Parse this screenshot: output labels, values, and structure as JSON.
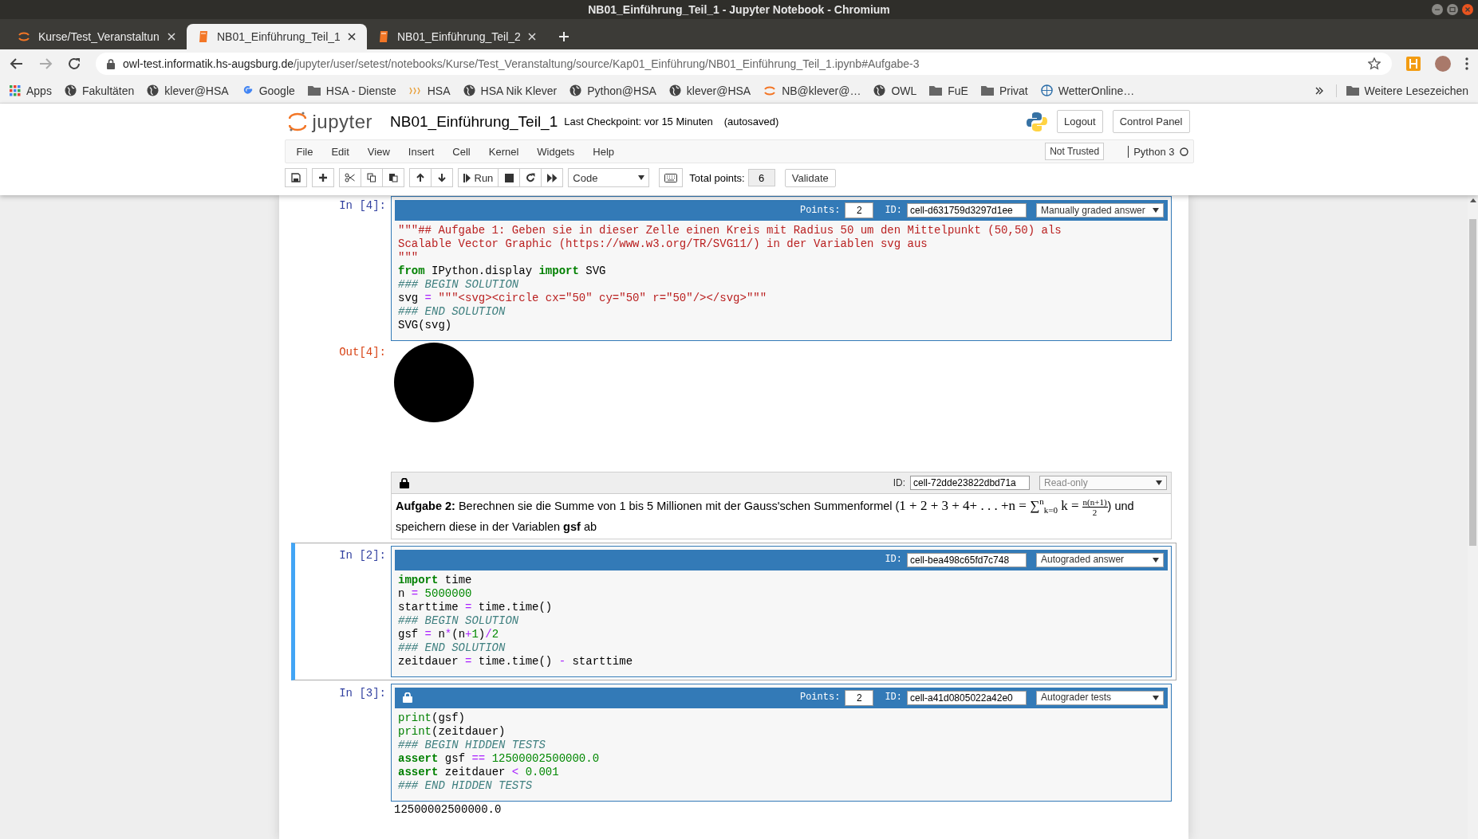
{
  "window": {
    "title": "NB01_Einführung_Teil_1 - Jupyter Notebook - Chromium"
  },
  "tabs": [
    {
      "title": "Kurse/Test_Veranstaltun",
      "selected": false
    },
    {
      "title": "NB01_Einführung_Teil_1",
      "selected": true
    },
    {
      "title": "NB01_Einführung_Teil_2",
      "selected": false
    }
  ],
  "address": {
    "host": "owl-test.informatik.hs-augsburg.de",
    "path": "/jupyter/user/setest/notebooks/Kurse/Test_Veranstaltung/source/Kap01_Einführung/NB01_Einführung_Teil_1.ipynb#Aufgabe-3"
  },
  "bookmarks": [
    {
      "label": "Apps"
    },
    {
      "label": "Fakultäten"
    },
    {
      "label": "klever@HSA"
    },
    {
      "label": "Google"
    },
    {
      "label": "HSA - Dienste"
    },
    {
      "label": "HSA"
    },
    {
      "label": "HSA Nik Klever"
    },
    {
      "label": "Python@HSA"
    },
    {
      "label": "klever@HSA"
    },
    {
      "label": "NB@klever@…"
    },
    {
      "label": "OWL"
    },
    {
      "label": "FuE"
    },
    {
      "label": "Privat"
    },
    {
      "label": "WetterOnline…"
    }
  ],
  "other_bookmarks": "Weitere Lesezeichen",
  "jupyter": {
    "logo_text": "jupyter",
    "notebook_name": "NB01_Einführung_Teil_1",
    "checkpoint": "Last Checkpoint: vor 15 Minuten",
    "autosave": "(autosaved)",
    "buttons": [
      "Logout",
      "Control Panel"
    ],
    "menu": [
      "File",
      "Edit",
      "View",
      "Insert",
      "Cell",
      "Kernel",
      "Widgets",
      "Help"
    ],
    "trust": "Not Trusted",
    "kernel": "Python 3",
    "kernel_busy": false,
    "toolbar": {
      "run": "Run",
      "cell_type": "Code",
      "total_points_label": "Total points:",
      "total_points": "6",
      "validate": "Validate"
    }
  },
  "cells": [
    {
      "kind": "code",
      "prompt": "In [4]:",
      "selected": false,
      "locked": false,
      "header": {
        "points_label": "Points:",
        "points": "2",
        "id_label": "ID:",
        "id": "cell-d631759d3297d1ee",
        "type": "Manually graded answer",
        "disabled": false
      },
      "lines": [
        [
          {
            "kind": "str",
            "text": "\"\"\"## Aufgabe 1: Geben sie in dieser Zelle einen Kreis mit Radius 50 um den Mittelpunkt (50,50) als"
          }
        ],
        [
          {
            "kind": "str",
            "text": "Scalable Vector Graphic (https://www.w3.org/TR/SVG11/) in der Variablen svg aus"
          }
        ],
        [
          {
            "kind": "str",
            "text": "\"\"\""
          }
        ],
        [
          {
            "kind": "kw",
            "text": "from"
          },
          {
            "kind": "p",
            "text": " IPython.display "
          },
          {
            "kind": "kw",
            "text": "import"
          },
          {
            "kind": "p",
            "text": " SVG"
          }
        ],
        [
          {
            "kind": "cm",
            "text": "### BEGIN SOLUTION"
          }
        ],
        [
          {
            "kind": "p",
            "text": "svg "
          },
          {
            "kind": "op",
            "text": "="
          },
          {
            "kind": "str",
            "text": " \"\"\"<svg><circle cx=\"50\" cy=\"50\" r=\"50\"/></svg>\"\"\""
          }
        ],
        [
          {
            "kind": "cm",
            "text": "### END SOLUTION"
          }
        ],
        [
          {
            "kind": "p",
            "text": "SVG(svg)"
          }
        ]
      ],
      "output": {
        "kind": "circle",
        "prompt": "Out[4]:"
      }
    },
    {
      "kind": "markdown",
      "selected": false,
      "locked": true,
      "header": {
        "id_label": "ID:",
        "id": "cell-72dde23822dbd71a",
        "type": "Read-only",
        "disabled": true
      },
      "text": "**Aufgabe 2:** Berechnen sie die Summe von 1 bis 5 Millionen mit der Gauss'schen Summenformel (",
      "formula": "1 + 2 + 3 + 4+ . . . +n = ∑$^{n}$$_{k=0}$ k =",
      "fraction": {
        "numerator": "n(n+1)",
        "denominator": "2"
      },
      "text_after": ") und speichern diese in der Variablen **gsf** ab"
    },
    {
      "kind": "code",
      "prompt": "In [2]:",
      "selected": true,
      "locked": false,
      "header": {
        "id_label": "ID:",
        "id": "cell-bea498c65fd7c748",
        "type": "Autograded answer",
        "disabled": false
      },
      "lines": [
        [
          {
            "kind": "kw",
            "text": "import"
          },
          {
            "kind": "p",
            "text": " time"
          }
        ],
        [
          {
            "kind": "p",
            "text": "n "
          },
          {
            "kind": "op",
            "text": "="
          },
          {
            "kind": "num",
            "text": " 5000000"
          }
        ],
        [
          {
            "kind": "p",
            "text": "starttime "
          },
          {
            "kind": "op",
            "text": "="
          },
          {
            "kind": "p",
            "text": " time.time()"
          }
        ],
        [
          {
            "kind": "cm",
            "text": "### BEGIN SOLUTION"
          }
        ],
        [
          {
            "kind": "p",
            "text": "gsf "
          },
          {
            "kind": "op",
            "text": "="
          },
          {
            "kind": "p",
            "text": " n"
          },
          {
            "kind": "op",
            "text": "*"
          },
          {
            "kind": "p",
            "text": "(n"
          },
          {
            "kind": "op",
            "text": "+"
          },
          {
            "kind": "num",
            "text": "1"
          },
          {
            "kind": "p",
            "text": ")"
          },
          {
            "kind": "op",
            "text": "/"
          },
          {
            "kind": "num",
            "text": "2"
          }
        ],
        [
          {
            "kind": "cm",
            "text": "### END SOLUTION"
          }
        ],
        [
          {
            "kind": "p",
            "text": "zeitdauer "
          },
          {
            "kind": "op",
            "text": "="
          },
          {
            "kind": "p",
            "text": " time.time() "
          },
          {
            "kind": "op",
            "text": "-"
          },
          {
            "kind": "p",
            "text": " starttime"
          }
        ]
      ]
    },
    {
      "kind": "code",
      "prompt": "In [3]:",
      "selected": false,
      "locked": true,
      "header": {
        "points_label": "Points:",
        "points": "2",
        "id_label": "ID:",
        "id": "cell-a41d0805022a42e0",
        "type": "Autograder tests",
        "disabled": false
      },
      "lines": [
        [
          {
            "kind": "bi",
            "text": "print"
          },
          {
            "kind": "p",
            "text": "(gsf)"
          }
        ],
        [
          {
            "kind": "bi",
            "text": "print"
          },
          {
            "kind": "p",
            "text": "(zeitdauer)"
          }
        ],
        [
          {
            "kind": "cm",
            "text": "### BEGIN HIDDEN TESTS"
          }
        ],
        [
          {
            "kind": "kw",
            "text": "assert"
          },
          {
            "kind": "p",
            "text": " gsf "
          },
          {
            "kind": "op",
            "text": "=="
          },
          {
            "kind": "num",
            "text": " 12500002500000.0"
          }
        ],
        [
          {
            "kind": "kw",
            "text": "assert"
          },
          {
            "kind": "p",
            "text": " zeitdauer "
          },
          {
            "kind": "op",
            "text": "<"
          },
          {
            "kind": "num",
            "text": " 0.001"
          }
        ],
        [
          {
            "kind": "cm",
            "text": "### END HIDDEN TESTS"
          }
        ]
      ],
      "output": {
        "kind": "text",
        "text": "12500002500000.0"
      }
    }
  ]
}
